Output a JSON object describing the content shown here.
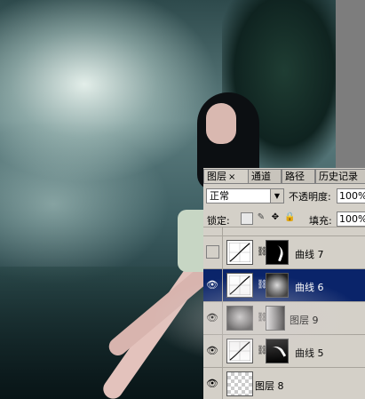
{
  "layers_panel": {
    "tabs": [
      {
        "label": "图层",
        "close": "×"
      },
      {
        "label": "通道"
      },
      {
        "label": "路径"
      },
      {
        "label": "历史记录"
      }
    ],
    "blend_mode": "正常",
    "opacity_label": "不透明度:",
    "opacity_value": "100%",
    "lock_label": "锁定:",
    "fill_label": "填充:",
    "fill_value": "100%",
    "layers": [
      {
        "name": "曲线 7",
        "visible": false,
        "selected": false
      },
      {
        "name": "曲线 6",
        "visible": true,
        "selected": true
      },
      {
        "name": "图层 9",
        "visible": true,
        "selected": false
      },
      {
        "name": "曲线 5",
        "visible": true,
        "selected": false
      },
      {
        "name": "图层 8",
        "visible": true,
        "selected": false
      }
    ]
  },
  "icons": {
    "eye": "👁",
    "chain": "⛓",
    "brush": "✎",
    "move": "✥",
    "lock": "🔒"
  },
  "colors": {
    "panel_bg": "#d4d0c8",
    "selection": "#0a246a"
  }
}
